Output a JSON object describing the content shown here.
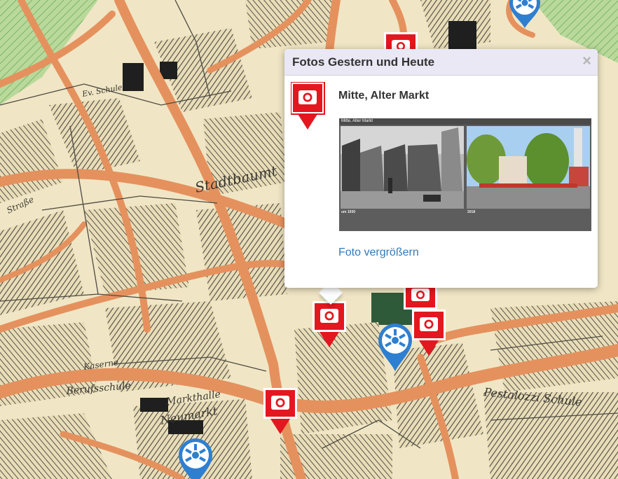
{
  "map": {
    "street_labels": [
      "Stadtbaumt",
      "Markthalle",
      "Neumarkt",
      "Pestalozzi Schule",
      "Berufsschule",
      "Kaserne",
      "Ev. Schule",
      "Straße"
    ]
  },
  "popup": {
    "title": "Fotos Gestern und Heute",
    "close_label": "×",
    "place": "Mitte, Alter Markt",
    "photo": {
      "header": "Mitte, Alter Markt",
      "left_year": "um 1930",
      "right_year": "2018"
    },
    "enlarge_link": "Foto vergrößern"
  },
  "colors": {
    "marker_red": "#e3171f",
    "marker_blue": "#2f7fd0",
    "link": "#337ab7"
  },
  "icons": [
    "camera-marker-icon",
    "info-marker-icon",
    "close-icon"
  ]
}
